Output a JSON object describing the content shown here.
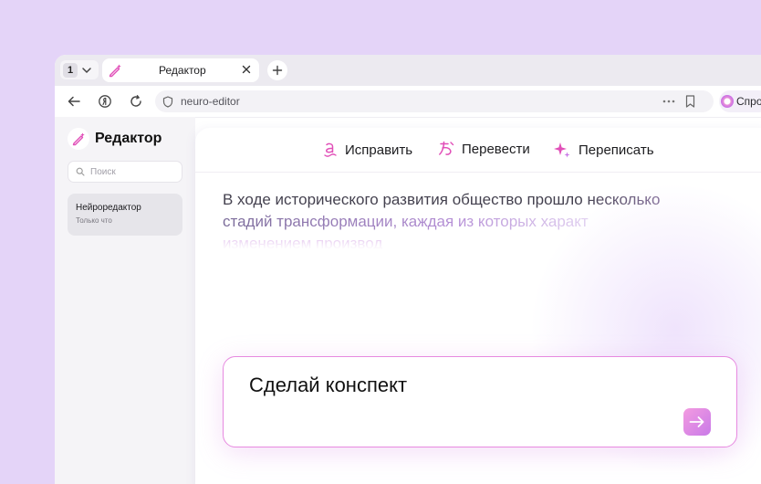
{
  "browser": {
    "tab_count": "1",
    "tab_title": "Редактор",
    "url": "neuro-editor",
    "ask_label": "Спро"
  },
  "sidebar": {
    "brand": "Редактор",
    "search_placeholder": "Поиск",
    "documents": [
      {
        "title": "Нейроредактор",
        "subtitle": "Только что"
      }
    ]
  },
  "toolbar": {
    "fix_label": "Исправить",
    "translate_label": "Перевести",
    "rewrite_label": "Переписать"
  },
  "editor": {
    "lines": [
      "В ходе исторического развития общество прошло несколько",
      "стадий трансформации, каждая из которых характ",
      "изменением производ"
    ]
  },
  "prompt": {
    "value": "Сделай конспект"
  },
  "colors": {
    "accent_pink": "#e78ae0",
    "accent_purple": "#c97ae8",
    "background": "#e4d4f8"
  },
  "icons": {
    "fix": "spellcheck-icon",
    "translate": "translate-icon",
    "rewrite": "sparkle-icon",
    "send": "arrow-right-icon"
  }
}
